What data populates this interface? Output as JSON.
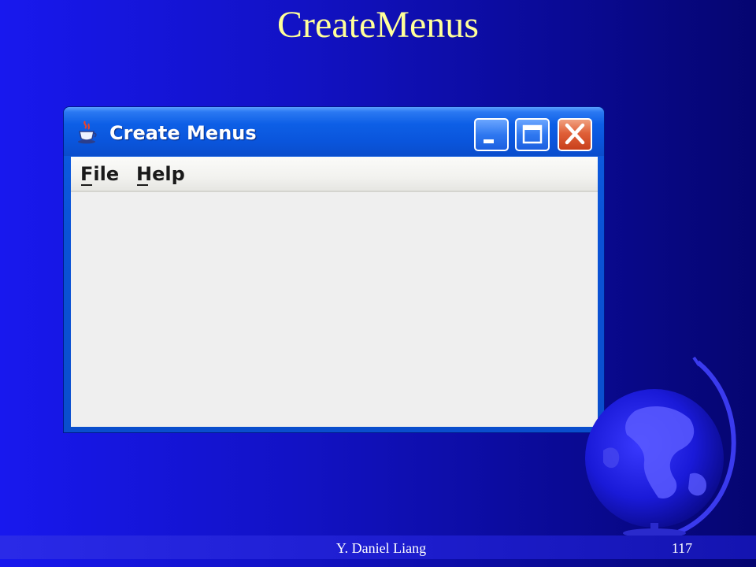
{
  "slide": {
    "title": "CreateMenus"
  },
  "window": {
    "title": "Create Menus",
    "app_icon": "java-cup-icon",
    "controls": {
      "minimize_icon": "minimize-icon",
      "maximize_icon": "maximize-icon",
      "close_icon": "close-icon"
    },
    "menubar": {
      "items": [
        {
          "label": "File",
          "mnemonic": "F"
        },
        {
          "label": "Help",
          "mnemonic": "H"
        }
      ]
    }
  },
  "decorations": {
    "globe_icon": "globe-icon"
  },
  "footer": {
    "author": "Y. Daniel Liang",
    "page_number": "117"
  },
  "colors": {
    "title_text": "#ffff99",
    "slide_background": "#1212c4",
    "titlebar_blue": "#0a55dc",
    "close_button_red": "#e06038",
    "client_background": "#efefef"
  }
}
